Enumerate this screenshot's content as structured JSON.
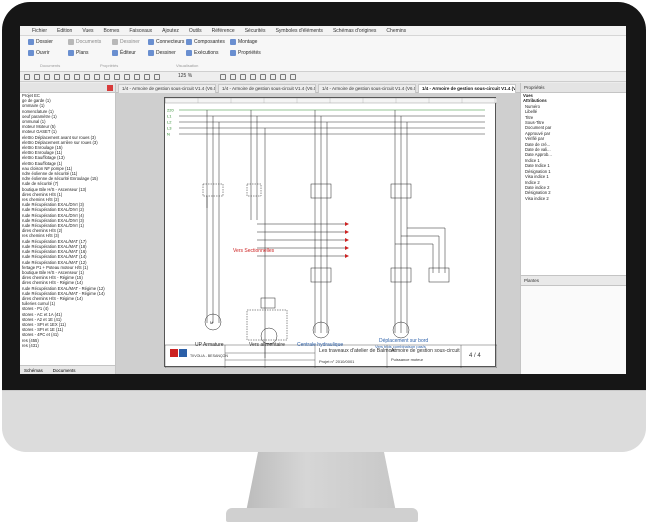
{
  "menu": [
    "Fichier",
    "Edition",
    "Vues",
    "Bornes",
    "Faisceaux",
    "Ajoutez",
    "Outils",
    "Référence",
    "Sécurités",
    "Symboles d'éléments",
    "Schémas d'origines",
    "Chemins"
  ],
  "ribbon": {
    "buttons": [
      "Dossier",
      "Documents",
      "Dessiner",
      "Connecteurs",
      "Composantes",
      "Montage",
      "Ouvrir",
      "Plans",
      "Éditeur",
      "Dessiner",
      "Exécutions",
      "Propriétés"
    ],
    "groups": [
      "Documents",
      "Propriétés",
      "Visualisation"
    ]
  },
  "toolbar": {
    "zoom": "125 %"
  },
  "tabs": [
    {
      "label": "1/4 - Armoire de gestion sous-circuit V1.4 (V6.0)",
      "active": false
    },
    {
      "label": "1/4 - Armoire de gestion sous-circuit V1.4 (V6.0)",
      "active": false
    },
    {
      "label": "1/4 - Armoire de gestion sous-circuit V1.4 (V6.0)",
      "active": false
    },
    {
      "label": "1/4 - Armoire de gestion sous-circuit V1.4 (V6.0)",
      "active": true
    }
  ],
  "left_panel": {
    "items": [
      "Projet EC",
      "ge de garde (1)",
      "ommaire (1)",
      "nomenclature (1)",
      "oeuf paramètre (1)",
      "ommunal (1)",
      "moteur Moteur (5)",
      "moteur GASET (1)",
      "elettro Déplacement avant sur roues (3)",
      "elettro Déplacement arrière sur roues (3)",
      "elettro Enroulage (15)",
      "elettro Enroulage (11)",
      "elettro Eau/flotage (13)",
      "elettro Eau/flotage (1)",
      "eau cloison NF pompe (11)",
      "ndre éolienne de sécurité (11)",
      "ndre éolienne de sécurité Enroulage (15)",
      "rude de sécurité (7)",
      "boutique Bile H/S - Ascenseur (13)",
      "dires chemins H/S (1)",
      "res chemins H/S (2)",
      "rude Récupération EXAL/DIVI (3)",
      "rude Récupération EXAL/DIVI (2)",
      "rude Récupération EXAL/DIVI (4)",
      "rude Récupération EXAL/DIVI (3)",
      "rude Récupération EXAL/DIVI (1)",
      "dires chemins H/S (2)",
      "res chemins H/S (3)",
      "rude Récupération EXAL/MAT (17)",
      "rude Récupération EXAL/MAT (18)",
      "rude Récupération EXAL/MAT (16)",
      "rude Récupération EXAL/MAT (14)",
      "rude Récupération EXAL/MAT (12)",
      "fertage P1 + Poteau moteur H/S (1)",
      "boutique Bile H/S - Ascenseur (1)",
      "dires chemins H/S - Régime (15)",
      "dires chemins H/S - Régime (14)",
      "rude Récupération EXAL/MAT - Régime (12)",
      "rude Récupération EXAL/MAT - Régime (14)",
      "dires chemins H/S - Régime (14)",
      "tuileries cumul (1)",
      "stores - P1 (4)",
      "stores - AC et 1A (41)",
      "stores - A2 et 1E (41)",
      "stores - SPI et 1EX (11)",
      "stores - SPI et 1E (11)",
      "stores - 4PC et (41)",
      "res (455)",
      "res (431)"
    ],
    "footer": [
      "Schémas",
      "Documents"
    ]
  },
  "right_panel": {
    "title": "Propriétés",
    "rows": [
      {
        "text": "Vues",
        "bold": true
      },
      {
        "text": "Attributions",
        "bold": true
      },
      {
        "text": "Numéro",
        "bold": false
      },
      {
        "text": "Libellé",
        "bold": false
      },
      {
        "text": "Titre",
        "bold": false
      },
      {
        "text": "Sous-Titre",
        "bold": false
      },
      {
        "text": "Document par",
        "bold": false
      },
      {
        "text": "Approuvé par",
        "bold": false
      },
      {
        "text": "Vérifié par",
        "bold": false
      },
      {
        "text": "Date de cré...",
        "bold": false
      },
      {
        "text": "Date de vali...",
        "bold": false
      },
      {
        "text": "Date Approb...",
        "bold": false
      },
      {
        "text": "Indice 1",
        "bold": false
      },
      {
        "text": "Date Indice 1",
        "bold": false
      },
      {
        "text": "Désignation 1",
        "bold": false
      },
      {
        "text": "Visa indice 1",
        "bold": false
      },
      {
        "text": "Indice 2",
        "bold": false
      },
      {
        "text": "Date indice 2",
        "bold": false
      },
      {
        "text": "Désignation 2",
        "bold": false
      },
      {
        "text": "Visa indice 2",
        "bold": false
      }
    ],
    "subpanel_title": "Plantes"
  },
  "schema": {
    "rails": [
      "220",
      "L1",
      "L2",
      "L3",
      "N"
    ],
    "labels": {
      "vers_sectionnelles": "Vers Sectionnelles",
      "vers_alim": "Vers alimentaire",
      "motor1": "UP Armature",
      "motor2": "Centrale hydraulique",
      "motor3": "Déplacement sur bord",
      "motor3_sub": "Vers trois combinaison pas/s"
    },
    "cartouche": {
      "company": "TIIVOLIA - BESANÇON",
      "title": "Les traveaux d'atelier de Balmont",
      "subtitle": "Armoire de gestion sous-circuit",
      "sub2": "Puissance moteur",
      "doc_ref": "Projet n° 2010/0001",
      "folio": "4 / 4"
    }
  }
}
